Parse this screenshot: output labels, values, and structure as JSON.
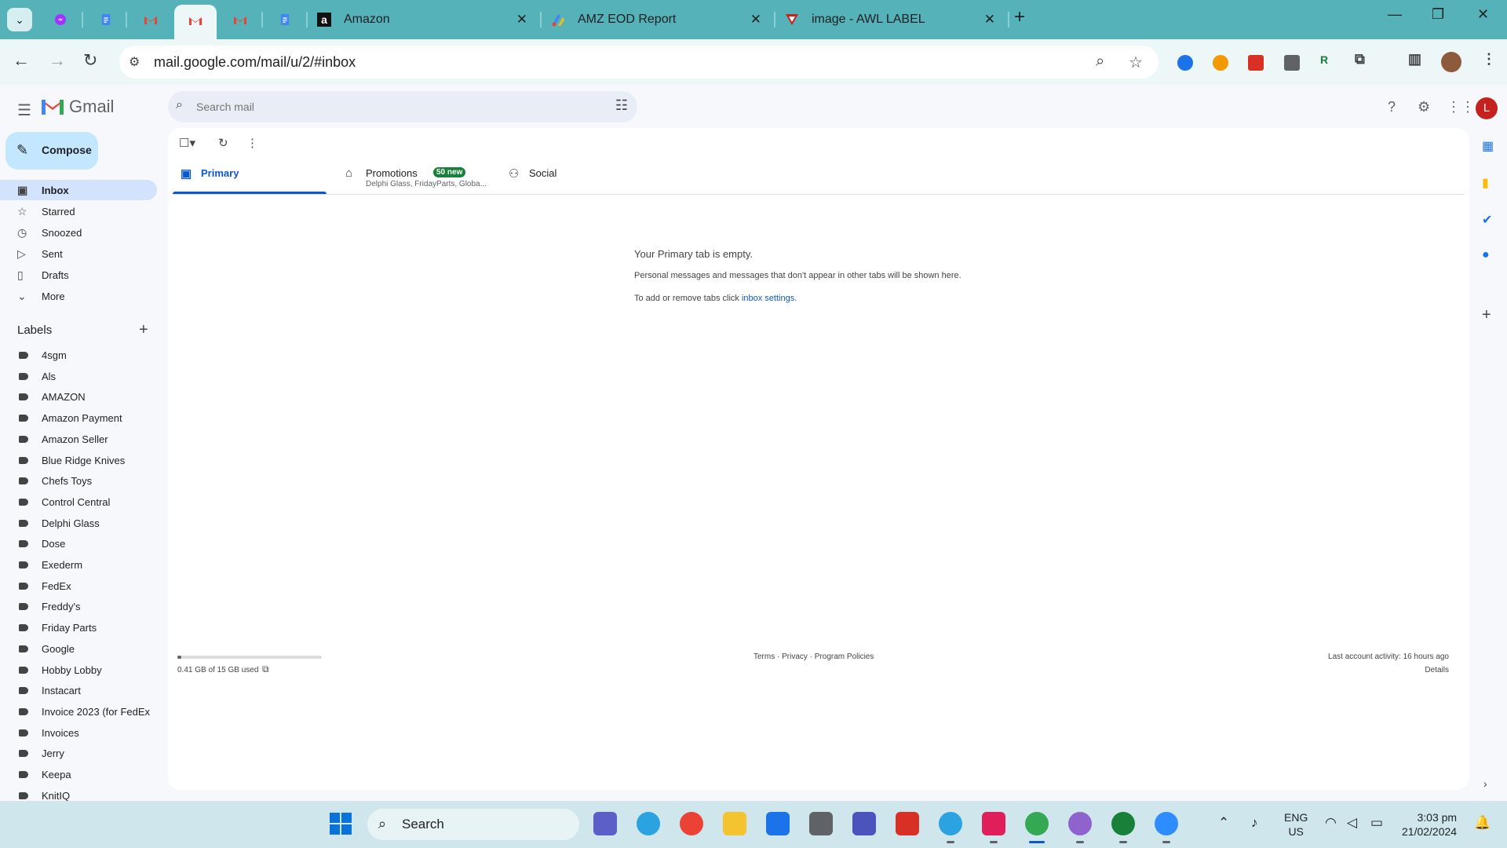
{
  "browser": {
    "tabs": [
      {
        "label": "Amazon"
      },
      {
        "label": "AMZ EOD Report"
      },
      {
        "label": "image - AWL LABEL"
      }
    ],
    "close_glyph": "✕",
    "new_tab_glyph": "+",
    "url": "mail.google.com/mail/u/2/#inbox",
    "window": {
      "minimize": "—",
      "restore": "❐",
      "close": "✕"
    }
  },
  "gmail": {
    "app_name": "Gmail",
    "search_placeholder": "Search mail",
    "avatar_letter": "L",
    "compose_label": "Compose",
    "nav": [
      {
        "label": "Inbox",
        "icon": "inbox-icon"
      },
      {
        "label": "Starred",
        "icon": "star-icon"
      },
      {
        "label": "Snoozed",
        "icon": "clock-icon"
      },
      {
        "label": "Sent",
        "icon": "send-icon"
      },
      {
        "label": "Drafts",
        "icon": "draft-icon"
      },
      {
        "label": "More",
        "icon": "chevron-down-icon"
      }
    ],
    "labels_title": "Labels",
    "labels": [
      "4sgm",
      "Als",
      "AMAZON",
      "Amazon Payment",
      "Amazon Seller",
      "Blue Ridge Knives",
      "Chefs Toys",
      "Control Central",
      "Delphi Glass",
      "Dose",
      "Exederm",
      "FedEx",
      "Freddy's",
      "Friday Parts",
      "Google",
      "Hobby Lobby",
      "Instacart",
      "Invoice 2023 (for FedEx ...",
      "Invoices",
      "Jerry",
      "Keepa",
      "KnitIQ"
    ],
    "tabs": {
      "primary": "Primary",
      "promotions": "Promotions",
      "promotions_badge": "50 new",
      "promotions_sub": "Delphi Glass, FridayParts, Globa...",
      "social": "Social"
    },
    "empty": {
      "title": "Your Primary tab is empty.",
      "line1": "Personal messages and messages that don't appear in other tabs will be shown here.",
      "line2_prefix": "To add or remove tabs click ",
      "line2_link": "inbox settings",
      "line2_suffix": "."
    },
    "footer": {
      "storage_used": "0.41 GB of 15 GB used",
      "storage_fraction": 0.027,
      "links": "Terms · Privacy · Program Policies",
      "last_activity": "Last account activity: 16 hours ago",
      "details": "Details"
    }
  },
  "taskbar": {
    "search_label": "Search",
    "lang_line1": "ENG",
    "lang_line2": "US",
    "time": "3:03 pm",
    "date": "21/02/2024"
  },
  "colors": {
    "tabstrip": "#54b2b8",
    "toolbar": "#eef7f8",
    "accent": "#0b57d0",
    "compose": "#c2e7ff",
    "badge": "#188038"
  }
}
